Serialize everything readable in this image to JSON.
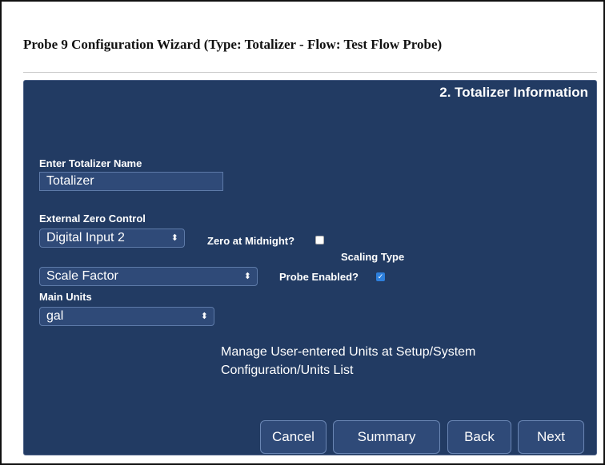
{
  "window": {
    "title": "Probe 9 Configuration Wizard (Type: Totalizer - Flow: Test Flow Probe)"
  },
  "panel": {
    "step_title": "2. Totalizer Information"
  },
  "form": {
    "name_label": "Enter Totalizer Name",
    "name_value": "Totalizer",
    "zero_control_label": "External Zero Control",
    "zero_control_value": "Digital Input 2",
    "zero_midnight_label": "Zero at Midnight?",
    "zero_midnight_checked": false,
    "scaling_type_label": "Scaling Type",
    "scaling_type_value": "Scale Factor",
    "probe_enabled_label": "Probe Enabled?",
    "probe_enabled_checked": true,
    "main_units_label": "Main Units",
    "main_units_value": "gal",
    "info_text": "Manage User-entered Units at Setup/System Configuration/Units List"
  },
  "buttons": {
    "cancel": "Cancel",
    "summary": "Summary",
    "back": "Back",
    "next": "Next"
  },
  "icons": {
    "select_arrows": "⬍",
    "checkmark": "✓"
  },
  "colors": {
    "panel_bg": "#223b63",
    "field_bg": "#2f4a78",
    "checkbox_on": "#2d7fdc"
  }
}
